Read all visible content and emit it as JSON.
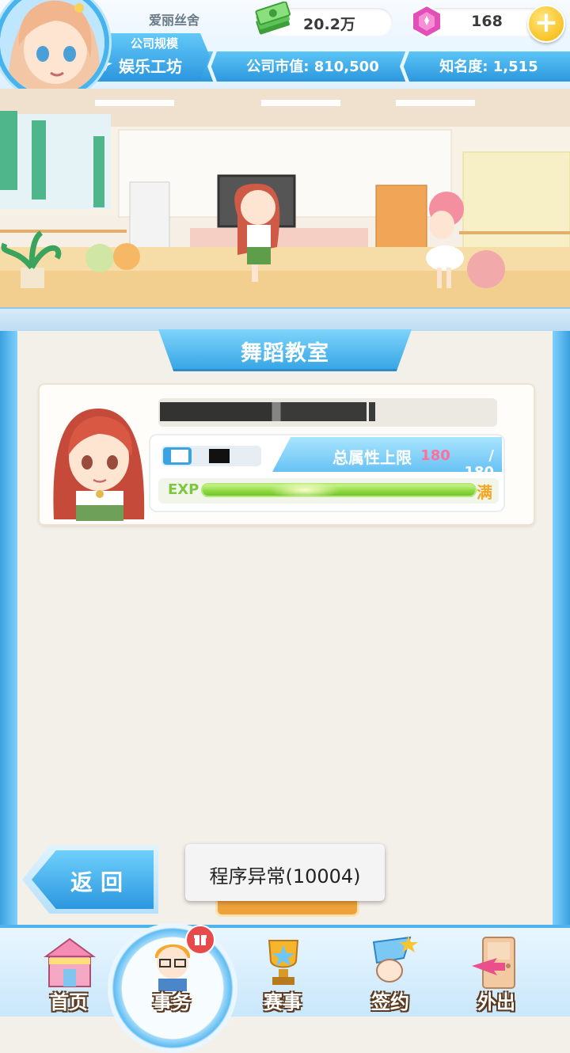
{
  "hud": {
    "player_name": "爱丽丝舍",
    "scale_label": "公司规模",
    "scale_value": "娱乐工坊",
    "money": "20.2万",
    "gems": "168",
    "company_value": "公司市值: 810,500",
    "fame": "知名度: 1,515",
    "add_currency_symbol": "+"
  },
  "panel": {
    "title": "舞蹈教室",
    "attr_label": "总属性上限",
    "attr_current": "180",
    "attr_max": "/ 180",
    "exp_label": "EXP",
    "exp_progress": 1.0,
    "exp_status": "满"
  },
  "back_button": {
    "label": "返回"
  },
  "toast": {
    "message": "程序异常(10004)"
  },
  "nav": {
    "items": [
      {
        "label": "首页",
        "icon": "shop-building-icon"
      },
      {
        "label": "事务",
        "icon": "manager-character-icon",
        "active": true
      },
      {
        "label": "赛事",
        "icon": "trophy-icon"
      },
      {
        "label": "签约",
        "icon": "contract-hand-icon"
      },
      {
        "label": "外出",
        "icon": "door-exit-icon"
      }
    ]
  },
  "colors": {
    "accent": "#39a6e6",
    "gold": "#f5b400",
    "exp_green": "#8ad63d",
    "pink_value": "#ff6f9a"
  }
}
